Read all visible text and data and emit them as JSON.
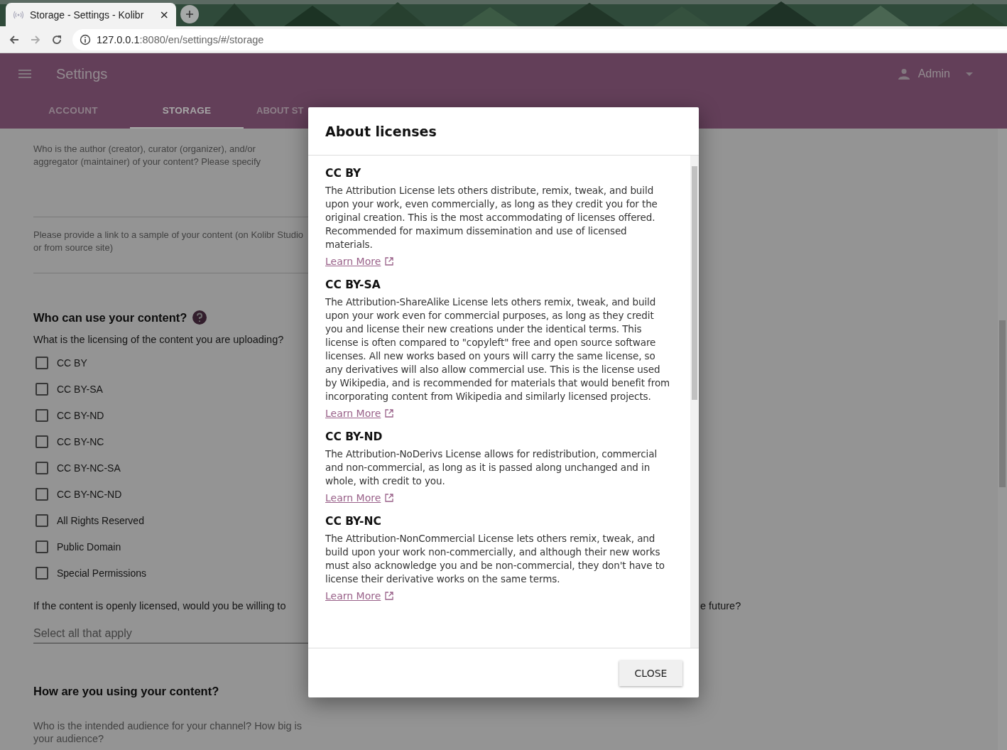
{
  "browser": {
    "tab_title": "Storage - Settings - Kolibr",
    "tab_close": "×",
    "url_host": "127.0.0.1",
    "url_path": ":8080/en/settings/#/storage"
  },
  "app_bar": {
    "title": "Settings",
    "user": "Admin"
  },
  "tabs": [
    {
      "label": "ACCOUNT",
      "selected": false
    },
    {
      "label": "STORAGE",
      "selected": true
    },
    {
      "label": "ABOUT ST",
      "selected": false
    }
  ],
  "form": {
    "author_placeholder": "Who is the author (creator), curator (organizer), and/or aggregator (maintainer) of your content? Please specify",
    "sample_placeholder": "Please provide a link to a sample of your content (on Kolibr Studio or from source site)",
    "licensing_heading": "Who can use your content?",
    "licensing_question": "What is the licensing of the content you are uploading?",
    "licenses": [
      {
        "label": "CC BY",
        "checked": false
      },
      {
        "label": "CC BY-SA",
        "checked": false
      },
      {
        "label": "CC BY-ND",
        "checked": false
      },
      {
        "label": "CC BY-NC",
        "checked": false
      },
      {
        "label": "CC BY-NC-SA",
        "checked": false
      },
      {
        "label": "CC BY-NC-ND",
        "checked": false
      },
      {
        "label": "All Rights Reserved",
        "checked": false
      },
      {
        "label": "Public Domain",
        "checked": false
      },
      {
        "label": "Special Permissions",
        "checked": false
      }
    ],
    "open_question_start": "If the content is openly licensed, would you be willing to",
    "open_question_end": "e future?",
    "select_placeholder": "Select all that apply",
    "usage_heading": "How are you using your content?",
    "audience_placeholder": "Who is the intended audience for your channel? How big is your audience?"
  },
  "dialog": {
    "title": "About licenses",
    "sections": [
      {
        "name": "CC BY",
        "text": "The Attribution License lets others distribute, remix, tweak, and build upon your work, even commercially, as long as they credit you for the original creation. This is the most accommodating of licenses offered. Recommended for maximum dissemination and use of licensed materials.",
        "link": "Learn More"
      },
      {
        "name": "CC BY-SA",
        "text": "The Attribution-ShareAlike License lets others remix, tweak, and build upon your work even for commercial purposes, as long as they credit you and license their new creations under the identical terms. This license is often compared to \"copyleft\" free and open source software licenses. All new works based on yours will carry the same license, so any derivatives will also allow commercial use. This is the license used by Wikipedia, and is recommended for materials that would benefit from incorporating content from Wikipedia and similarly licensed projects.",
        "link": "Learn More"
      },
      {
        "name": "CC BY-ND",
        "text": "The Attribution-NoDerivs License allows for redistribution, commercial and non-commercial, as long as it is passed along unchanged and in whole, with credit to you.",
        "link": "Learn More"
      },
      {
        "name": "CC BY-NC",
        "text": "The Attribution-NonCommercial License lets others remix, tweak, and build upon your work non-commercially, and although their new works must also acknowledge you and be non-commercial, they don't have to license their derivative works on the same terms.",
        "link": "Learn More"
      }
    ],
    "close_button": "CLOSE"
  }
}
